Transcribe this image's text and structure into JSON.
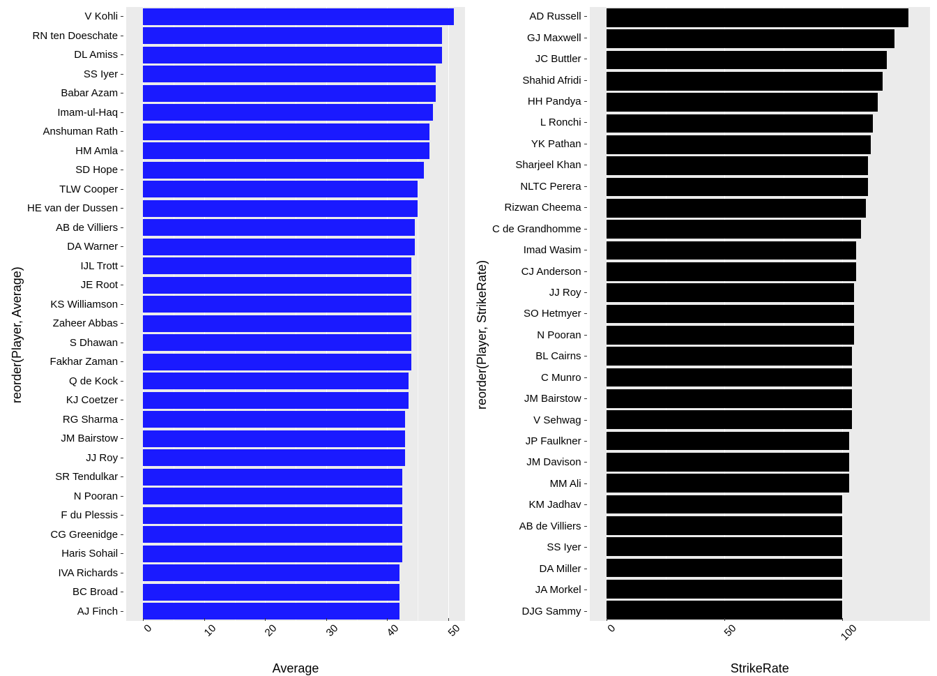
{
  "chart_data": [
    {
      "type": "bar",
      "title": "",
      "ylabel": "reorder(Player, Average)",
      "xlabel": "Average",
      "xlim": [
        0,
        50
      ],
      "xticks": [
        0,
        10,
        20,
        30,
        40,
        50
      ],
      "fill": "#1a1aff",
      "categories": [
        "V Kohli",
        "RN ten Doeschate",
        "DL Amiss",
        "SS Iyer",
        "Babar Azam",
        "Imam-ul-Haq",
        "Anshuman Rath",
        "HM Amla",
        "SD Hope",
        "TLW Cooper",
        "HE van der Dussen",
        "AB de Villiers",
        "DA Warner",
        "IJL Trott",
        "JE Root",
        "KS Williamson",
        "Zaheer Abbas",
        "S Dhawan",
        "Fakhar Zaman",
        "Q de Kock",
        "KJ Coetzer",
        "RG Sharma",
        "JM Bairstow",
        "JJ Roy",
        "SR Tendulkar",
        "N Pooran",
        "F du Plessis",
        "CG Greenidge",
        "Haris Sohail",
        "IVA Richards",
        "BC Broad",
        "AJ Finch"
      ],
      "values": [
        51,
        49,
        49,
        48,
        48,
        47.5,
        47,
        47,
        46,
        45,
        45,
        44.5,
        44.5,
        44,
        44,
        44,
        44,
        44,
        44,
        43.5,
        43.5,
        43,
        43,
        43,
        42.5,
        42.5,
        42.5,
        42.5,
        42.5,
        42,
        42,
        42
      ]
    },
    {
      "type": "bar",
      "title": "",
      "ylabel": "reorder(Player, StrikeRate)",
      "xlabel": "StrikeRate",
      "xlim": [
        0,
        130
      ],
      "xticks": [
        0,
        50,
        100
      ],
      "fill": "#000000",
      "categories": [
        "AD Russell",
        "GJ Maxwell",
        "JC Buttler",
        "Shahid Afridi",
        "HH Pandya",
        "L Ronchi",
        "YK Pathan",
        "Sharjeel Khan",
        "NLTC Perera",
        "Rizwan Cheema",
        "C de Grandhomme",
        "Imad Wasim",
        "CJ Anderson",
        "JJ Roy",
        "SO Hetmyer",
        "N Pooran",
        "BL Cairns",
        "C Munro",
        "JM Bairstow",
        "V Sehwag",
        "JP Faulkner",
        "JM Davison",
        "MM Ali",
        "KM Jadhav",
        "AB de Villiers",
        "SS Iyer",
        "DA Miller",
        "JA Morkel",
        "DJG Sammy"
      ],
      "values": [
        128,
        122,
        119,
        117,
        115,
        113,
        112,
        111,
        111,
        110,
        108,
        106,
        106,
        105,
        105,
        105,
        104,
        104,
        104,
        104,
        103,
        103,
        103,
        100,
        100,
        100,
        100,
        100,
        100
      ]
    }
  ]
}
